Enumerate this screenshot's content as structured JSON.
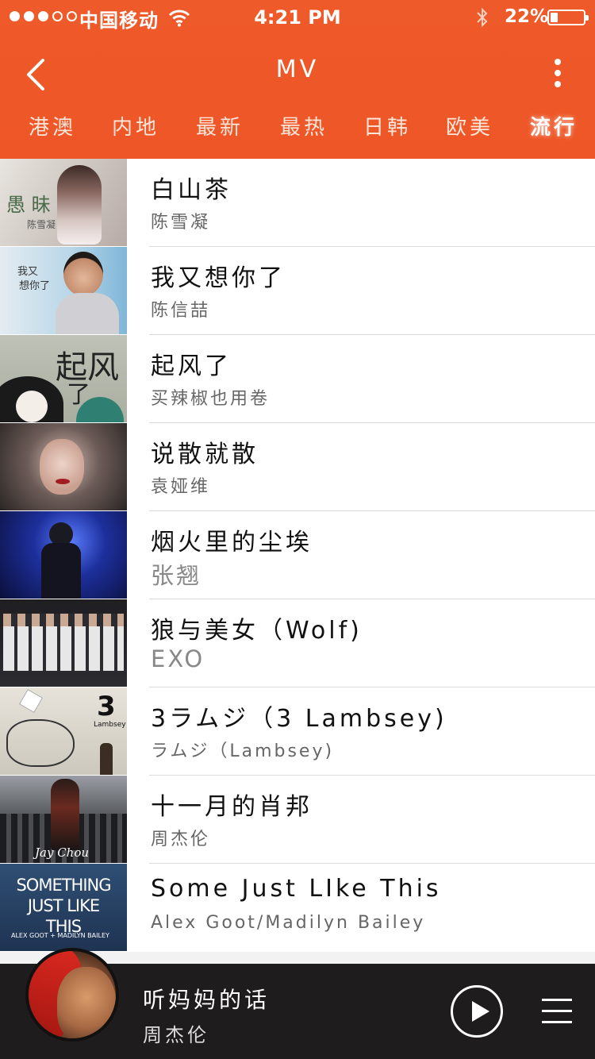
{
  "status_bar": {
    "carrier": "中国移动",
    "time": "4:21 PM",
    "battery_percent": "22%",
    "battery_level": 0.22,
    "signal_bars_filled": 3,
    "signal_bars_total": 5
  },
  "nav": {
    "title": "MV",
    "back_icon": "chevron-left-icon",
    "more_icon": "more-vertical-icon"
  },
  "tabs": [
    {
      "label": "港澳",
      "active": false
    },
    {
      "label": "内地",
      "active": false
    },
    {
      "label": "最新",
      "active": false
    },
    {
      "label": "最热",
      "active": false
    },
    {
      "label": "日韩",
      "active": false
    },
    {
      "label": "欧美",
      "active": false
    },
    {
      "label": "流行",
      "active": true
    }
  ],
  "mv_list": [
    {
      "title": "白山茶",
      "artist": "陈雪凝",
      "thumb_text": "愚 昧",
      "thumb_sub": "陈雪凝"
    },
    {
      "title": "我又想你了",
      "artist": "陈信喆",
      "thumb_text": "我又",
      "thumb_sub": "想你了"
    },
    {
      "title": "起风了",
      "artist": "买辣椒也用卷",
      "thumb_text": "起风",
      "thumb_sub": "了"
    },
    {
      "title": "说散就散",
      "artist": "袁娅维",
      "thumb_text": "",
      "thumb_sub": ""
    },
    {
      "title": "烟火里的尘埃",
      "artist": "张翘",
      "thumb_text": "",
      "thumb_sub": ""
    },
    {
      "title": "狼与美女（Wolf)",
      "artist": "EXO",
      "thumb_text": "",
      "thumb_sub": ""
    },
    {
      "title": "3ラムジ（3 Lambsey)",
      "artist": "ラムジ（Lambsey)",
      "thumb_text": "3",
      "thumb_sub": "Lambsey"
    },
    {
      "title": "十一月的肖邦",
      "artist": "周杰伦",
      "thumb_text": "Jay Chou",
      "thumb_sub": ""
    },
    {
      "title": "Some Just LIke This",
      "artist": "Alex Goot/Madilyn Bailey",
      "thumb_text": "SOMETHING JUST LIKE THIS",
      "thumb_sub": "ALEX GOOT + MADILYN BAILEY"
    }
  ],
  "player": {
    "song": "听妈妈的话",
    "artist": "周杰伦",
    "play_icon": "play-icon",
    "playlist_icon": "playlist-icon"
  },
  "colors": {
    "accent": "#EE5627",
    "player_bg": "#1E1C1C"
  }
}
